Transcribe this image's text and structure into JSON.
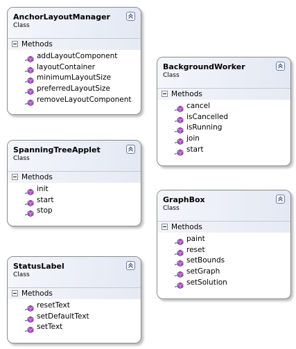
{
  "classes": [
    {
      "name": "AnchorLayoutManager",
      "kind": "Class",
      "section": "Methods",
      "methods": [
        "addLayoutComponent",
        "layoutContainer",
        "minimumLayoutSize",
        "preferredLayoutSize",
        "removeLayoutComponent"
      ]
    },
    {
      "name": "BackgroundWorker",
      "kind": "Class",
      "section": "Methods",
      "methods": [
        "cancel",
        "isCancelled",
        "isRunning",
        "join",
        "start"
      ]
    },
    {
      "name": "SpanningTreeApplet",
      "kind": "Class",
      "section": "Methods",
      "methods": [
        "init",
        "start",
        "stop"
      ]
    },
    {
      "name": "GraphBox",
      "kind": "Class",
      "section": "Methods",
      "methods": [
        "paint",
        "reset",
        "setBounds",
        "setGraph",
        "setSolution"
      ]
    },
    {
      "name": "StatusLabel",
      "kind": "Class",
      "section": "Methods",
      "methods": [
        "resetText",
        "setDefaultText",
        "setText"
      ]
    }
  ],
  "colors": {
    "method_icon": "#a64fbf",
    "border": "#8a8a8a",
    "header_gradient_start": "#f4f6fb",
    "header_gradient_end": "#e3e8f3"
  },
  "icons": {
    "collapse": "double-chevron-up-icon",
    "section_toggle": "minus-toggle-icon",
    "method": "method-icon"
  }
}
